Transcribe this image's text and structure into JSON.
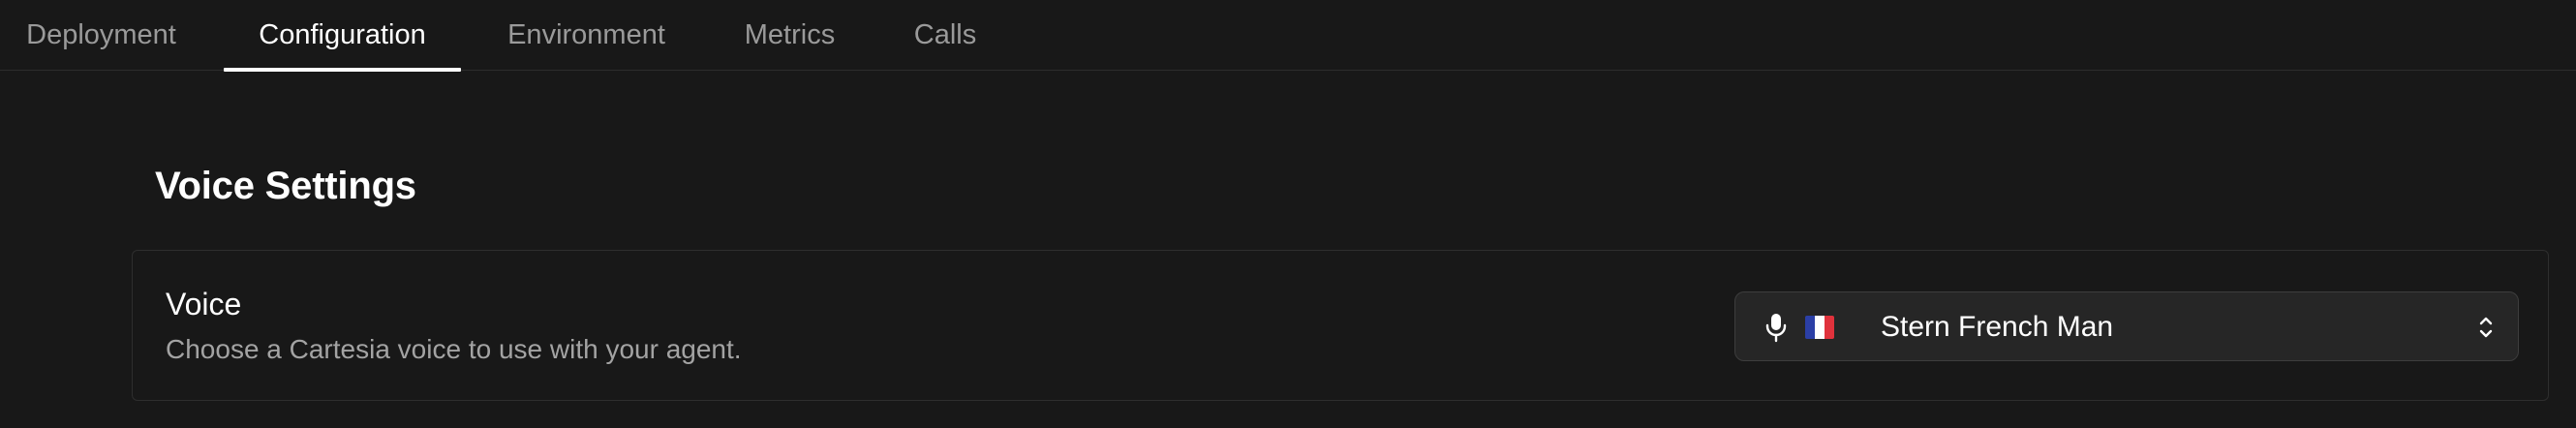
{
  "tabs": [
    {
      "label": "Deployment",
      "active": false
    },
    {
      "label": "Configuration",
      "active": true
    },
    {
      "label": "Environment",
      "active": false
    },
    {
      "label": "Metrics",
      "active": false
    },
    {
      "label": "Calls",
      "active": false
    }
  ],
  "section": {
    "title": "Voice Settings"
  },
  "voice_field": {
    "label": "Voice",
    "description": "Choose a Cartesia voice to use with your agent.",
    "selected_value": "Stern French Man",
    "leading_icon": "microphone-icon",
    "flag_icon": "france-flag-icon",
    "trailing_icon": "chevron-up-down-icon"
  },
  "colors": {
    "background": "#181818",
    "active_tab_text": "#ffffff",
    "inactive_tab_text": "#9a9a9a",
    "description_text": "#a3a3a3",
    "select_background": "#262626",
    "flag_blue": "#2b3fa6",
    "flag_white": "#ffffff",
    "flag_red": "#e0323c"
  }
}
